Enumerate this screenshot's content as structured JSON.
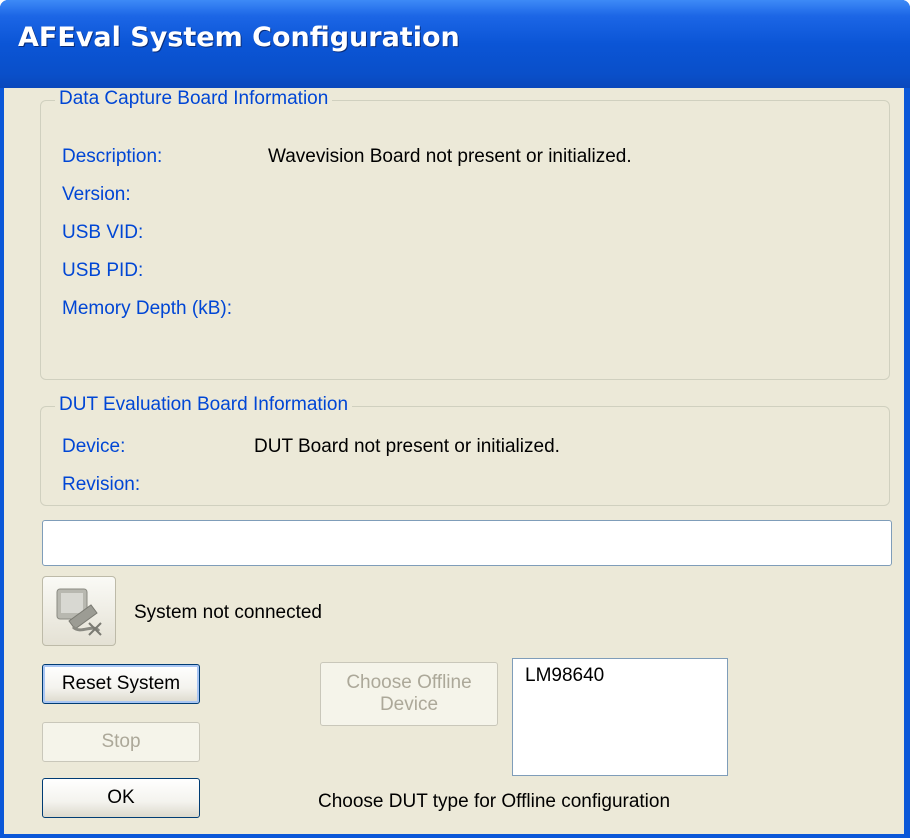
{
  "window": {
    "title": "AFEval System Configuration"
  },
  "data_capture": {
    "group_title": "Data Capture Board Information",
    "description_label": "Description:",
    "description_value": "Wavevision Board not present or initialized.",
    "version_label": "Version:",
    "usb_vid_label": "USB VID:",
    "usb_pid_label": "USB PID:",
    "memory_depth_label": "Memory Depth (kB):"
  },
  "dut": {
    "group_title": "DUT Evaluation Board Information",
    "device_label": "Device:",
    "device_value": "DUT Board not present or initialized.",
    "revision_label": "Revision:"
  },
  "status": {
    "text": "System not connected",
    "icon": "computer-disconnected-icon"
  },
  "buttons": {
    "reset": "Reset System",
    "stop": "Stop",
    "ok": "OK",
    "choose_offline_line1": "Choose Offline",
    "choose_offline_line2": "Device"
  },
  "offline_devices": {
    "items": [
      "LM98640"
    ]
  },
  "offline_hint": "Choose DUT type for Offline configuration"
}
